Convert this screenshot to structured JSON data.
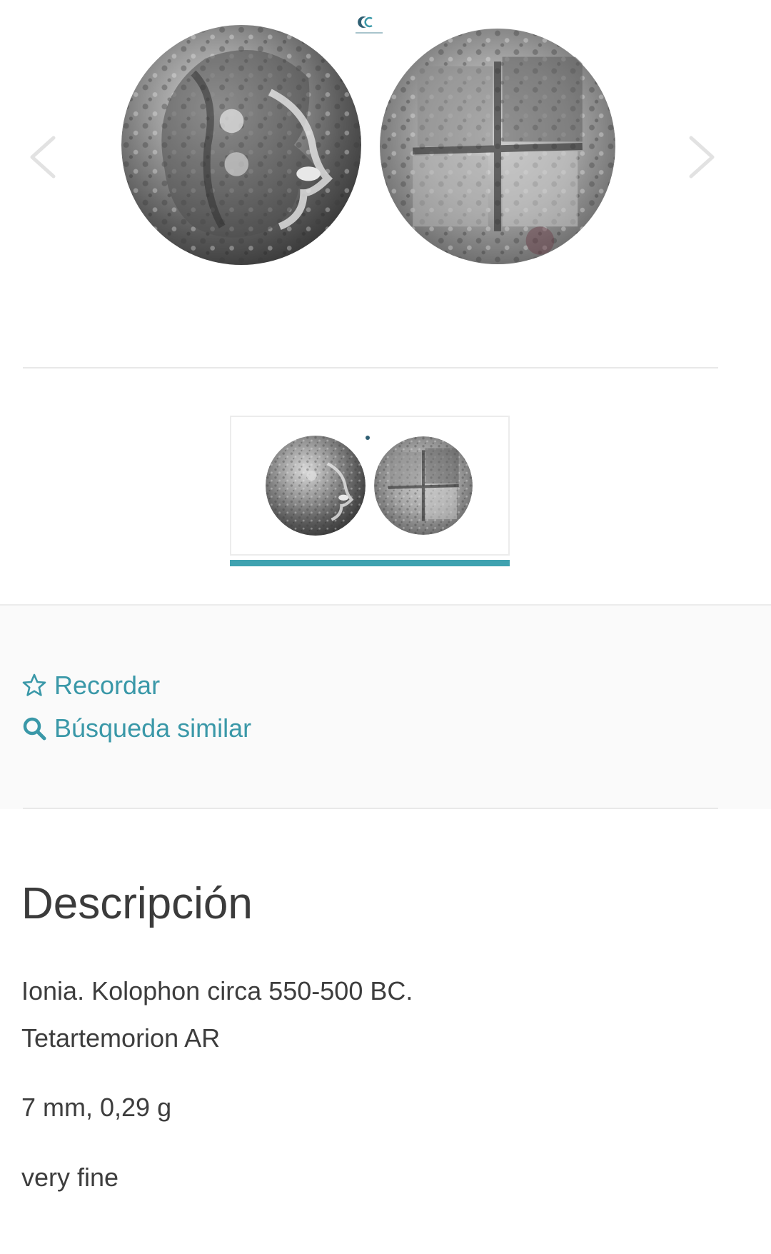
{
  "gallery": {
    "prev_icon": "chevron-left-icon",
    "next_icon": "chevron-right-icon",
    "main_image": {
      "obverse": "coin-obverse-helmeted-head",
      "reverse": "coin-reverse-incuse-square"
    },
    "thumbnails": [
      {
        "selected": true,
        "obverse": "coin-obverse-helmeted-head",
        "reverse": "coin-reverse-incuse-square"
      }
    ],
    "accent_color": "#3fa2b0"
  },
  "actions": {
    "remember": {
      "icon": "star-outline-icon",
      "label": "Recordar"
    },
    "similar": {
      "icon": "search-icon",
      "label": "Búsqueda similar"
    },
    "link_color": "#3a98a8"
  },
  "description": {
    "heading": "Descripción",
    "lines": [
      "Ionia. Kolophon circa 550-500 BC.",
      "Tetartemorion AR",
      "7 mm, 0,29 g",
      "very fine"
    ]
  }
}
